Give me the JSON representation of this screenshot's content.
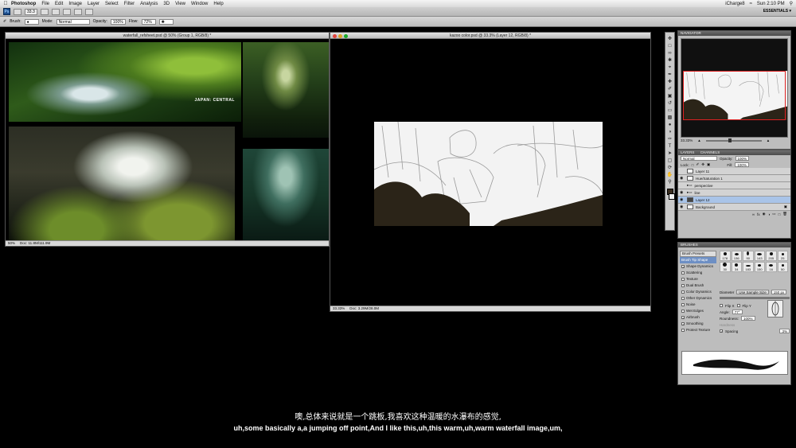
{
  "menubar": {
    "app_name": "Photoshop",
    "items": [
      "File",
      "Edit",
      "Image",
      "Layer",
      "Select",
      "Filter",
      "Analysis",
      "3D",
      "View",
      "Window",
      "Help"
    ],
    "clock": "Sun 2:10 PM",
    "user": "iCharge8"
  },
  "appbar": {
    "logo": "Ps",
    "zoom": "33.3",
    "workspace": "ESSENTIALS ▾"
  },
  "options": {
    "brush_label": "Brush:",
    "mode_label": "Mode:",
    "mode_value": "Normal",
    "opacity_label": "Opacity:",
    "opacity_value": "100%",
    "flow_label": "Flow:",
    "flow_value": "72%"
  },
  "ref_window": {
    "title": "waterfall_refsheet.psd @ 50% (Group 1, RGB/8) *",
    "overlay_text": "JAPAN: CENTRAL",
    "status_zoom": "50%",
    "status_doc": "Doc: 11.8M/111.9M"
  },
  "color_window": {
    "title": "kazoo color.psd @ 33.3% (Layer 12, RGB/8) *",
    "status_zoom": "33.33%",
    "status_doc": "Doc: 3.29M/28.0M"
  },
  "navigator": {
    "tab": "NAVIGATOR",
    "zoom": "33.33%"
  },
  "layers": {
    "tabs": [
      "LAYERS",
      "CHANNELS"
    ],
    "blend_mode": "Normal",
    "opacity_label": "Opacity:",
    "opacity_value": "100%",
    "lock_label": "Lock:",
    "fill_label": "Fill:",
    "fill_value": "100%",
    "rows": [
      {
        "name": "Layer 11",
        "dark": false,
        "active": false
      },
      {
        "name": "Hue/Saturation 1",
        "dark": false,
        "active": false
      },
      {
        "name": "perspective",
        "dark": false,
        "active": false
      },
      {
        "name": "line",
        "dark": false,
        "active": false
      },
      {
        "name": "Layer 12",
        "dark": true,
        "active": true
      },
      {
        "name": "Background",
        "dark": false,
        "active": false
      }
    ]
  },
  "brushes": {
    "tab": "BRUSHES",
    "presets_button": "Brush Presets",
    "options": [
      {
        "label": "Brush Tip Shape",
        "checked": false,
        "selected": true
      },
      {
        "label": "Shape Dynamics",
        "checked": true,
        "selected": false
      },
      {
        "label": "Scattering",
        "checked": false,
        "selected": false
      },
      {
        "label": "Texture",
        "checked": false,
        "selected": false
      },
      {
        "label": "Dual Brush",
        "checked": false,
        "selected": false
      },
      {
        "label": "Color Dynamics",
        "checked": false,
        "selected": false
      },
      {
        "label": "Other Dynamics",
        "checked": false,
        "selected": false
      },
      {
        "label": "Noise",
        "checked": false,
        "selected": false
      },
      {
        "label": "Wet Edges",
        "checked": false,
        "selected": false
      },
      {
        "label": "Airbrush",
        "checked": true,
        "selected": false
      },
      {
        "label": "Smoothing",
        "checked": true,
        "selected": false
      },
      {
        "label": "Protect Texture",
        "checked": false,
        "selected": false
      }
    ],
    "tip_sizes": [
      "178",
      "136",
      "90",
      "143",
      "205",
      "25",
      "30",
      "34",
      "183",
      "150",
      "16",
      "50"
    ],
    "diameter_label": "Diameter",
    "diameter_value": "150 px",
    "use_sample_size": "Use Sample Size",
    "flip_x": "Flip X",
    "flip_y": "Flip Y",
    "angle_label": "Angle:",
    "angle_value": "77°",
    "roundness_label": "Roundness:",
    "roundness_value": "100%",
    "hardness_label": "Hardness",
    "spacing_label": "Spacing",
    "spacing_value": "3%"
  },
  "subtitles": {
    "zh": "噢,总体来说就是一个跳板,我喜欢这种温暖的水瀑布的感觉,",
    "en": "uh,some basically a,a jumping off point,And I like this,uh,this warm,uh,warm waterfall image,um,"
  },
  "colors": {
    "foreground": "#3a2e20",
    "background": "#f2f2f2",
    "sketch_shadow": "#2b2418",
    "traffic_close": "#e0443e",
    "traffic_min": "#dea123",
    "traffic_max": "#1aab29"
  }
}
